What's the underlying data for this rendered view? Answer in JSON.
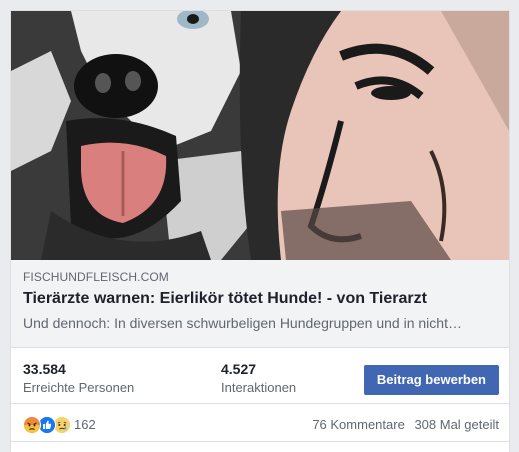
{
  "link_preview": {
    "domain": "FISCHUNDFLEISCH.COM",
    "title": "Tierärzte warnen: Eierlikör tötet Hunde! - von Tierarzt",
    "description": "Und dennoch: In diversen schwurbeligen Hundegruppen und in nicht…",
    "image": "stylized-dog-and-man-portrait"
  },
  "stats": {
    "reach_value": "33.584",
    "reach_label": "Erreichte Personen",
    "engagement_value": "4.527",
    "engagement_label": "Interaktionen",
    "boost_label": "Beitrag bewerben"
  },
  "reactions": {
    "icons": [
      "angry-icon",
      "like-icon",
      "sad-icon"
    ],
    "count": "162",
    "comments": "76 Kommentare",
    "shares": "308 Mal geteilt"
  },
  "colors": {
    "accent": "#4267b2",
    "secondary_text": "#606770",
    "primary_text": "#1d2129",
    "preview_bg": "#f2f3f5"
  }
}
